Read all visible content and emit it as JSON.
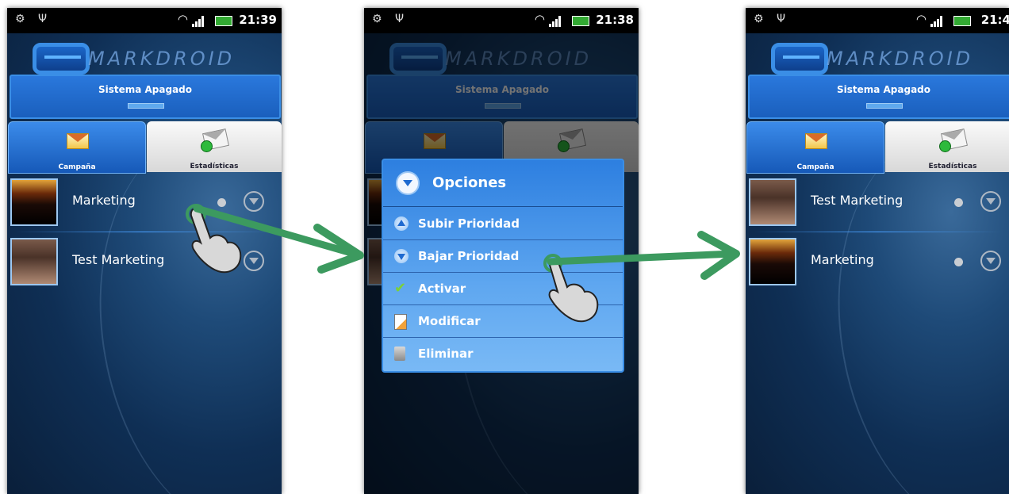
{
  "statusbar": {
    "time1": "21:39",
    "time2": "21:38",
    "time3": "21:4"
  },
  "app": {
    "logo_text": "MARKDROID"
  },
  "system": {
    "status": "Sistema Apagado"
  },
  "tabs": {
    "campaign": "Campaña",
    "stats": "Estadísticas"
  },
  "screen1": {
    "items": [
      "Marketing",
      "Test Marketing"
    ]
  },
  "screen3": {
    "items": [
      "Test Marketing",
      "Marketing"
    ]
  },
  "dialog": {
    "title": "Opciones",
    "options": [
      "Subir Prioridad",
      "Bajar Prioridad",
      "Activar",
      "Modificar",
      "Eliminar"
    ]
  },
  "colors": {
    "accent": "#2a78dc",
    "arrow": "#3c9a5f",
    "background": "#0f2f55"
  },
  "icons": [
    "android-icon",
    "usb-icon",
    "wifi-icon",
    "signal-icon",
    "battery-icon",
    "envelope-icon",
    "stats-envelope-icon",
    "chevron-down-icon",
    "hand-pointer-icon"
  ]
}
